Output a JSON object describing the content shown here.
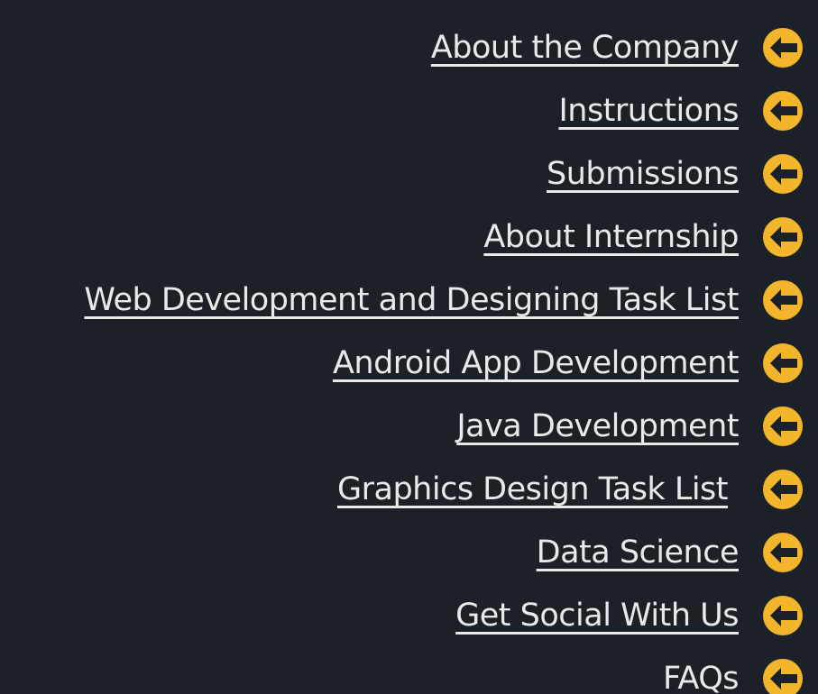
{
  "theme": {
    "background": "#1c2128",
    "link_color": "#e9e9e9",
    "icon_color": "#f2b52b"
  },
  "menu": {
    "items": [
      {
        "label": "About the Company",
        "icon": "arrow-left-icon"
      },
      {
        "label": "Instructions",
        "icon": "arrow-left-icon"
      },
      {
        "label": "Submissions",
        "icon": "arrow-left-icon"
      },
      {
        "label": "About Internship",
        "icon": "arrow-left-icon"
      },
      {
        "label": "Web Development and Designing Task List",
        "icon": "arrow-left-icon"
      },
      {
        "label": "Android App Development",
        "icon": "arrow-left-icon"
      },
      {
        "label": "Java Development",
        "icon": "arrow-left-icon"
      },
      {
        "label": "Graphics Design Task List",
        "icon": "arrow-left-icon"
      },
      {
        "label": "Data Science",
        "icon": "arrow-left-icon"
      },
      {
        "label": "Get Social With Us",
        "icon": "arrow-left-icon"
      },
      {
        "label": "FAQs",
        "icon": "arrow-left-icon"
      }
    ]
  }
}
